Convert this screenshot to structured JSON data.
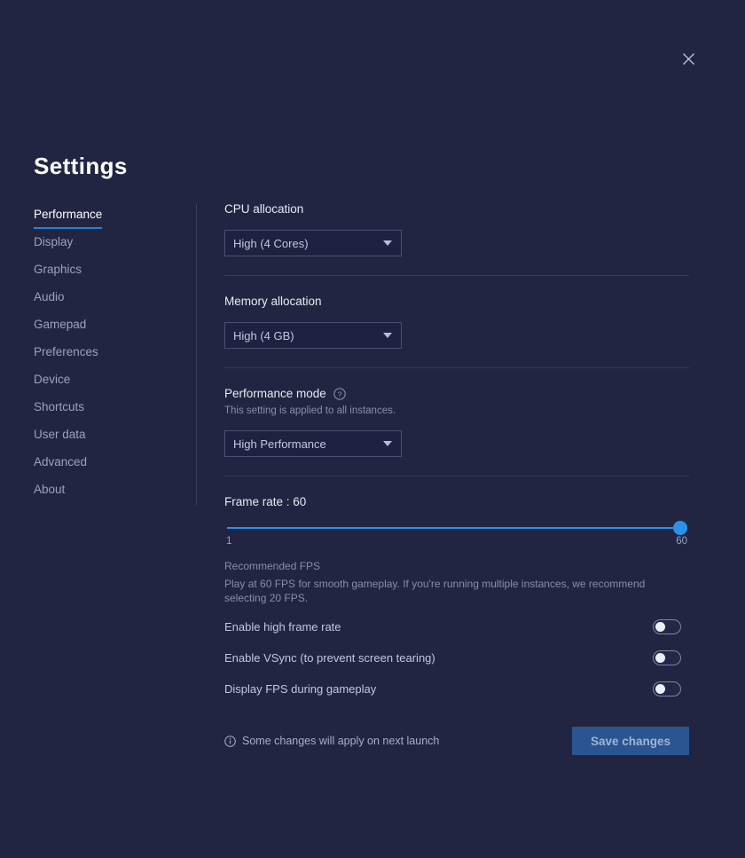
{
  "window": {
    "close_icon": "close-icon",
    "title": "Settings"
  },
  "sidebar": {
    "items": [
      {
        "label": "Performance",
        "active": true
      },
      {
        "label": "Display",
        "active": false
      },
      {
        "label": "Graphics",
        "active": false
      },
      {
        "label": "Audio",
        "active": false
      },
      {
        "label": "Gamepad",
        "active": false
      },
      {
        "label": "Preferences",
        "active": false
      },
      {
        "label": "Device",
        "active": false
      },
      {
        "label": "Shortcuts",
        "active": false
      },
      {
        "label": "User data",
        "active": false
      },
      {
        "label": "Advanced",
        "active": false
      },
      {
        "label": "About",
        "active": false
      }
    ]
  },
  "content": {
    "cpu": {
      "label": "CPU allocation",
      "value": "High (4 Cores)"
    },
    "memory": {
      "label": "Memory allocation",
      "value": "High (4 GB)"
    },
    "performance_mode": {
      "label": "Performance mode",
      "help_icon": "help-circle-icon",
      "description": "This setting is applied to all instances.",
      "value": "High Performance"
    },
    "frame_rate": {
      "label": "Frame rate : 60",
      "value": 60,
      "min_label": "1",
      "max_label": "60",
      "min": 1,
      "max": 60,
      "recommended_title": "Recommended FPS",
      "recommended_body": "Play at 60 FPS for smooth gameplay. If you're running multiple instances, we recommend selecting 20 FPS."
    },
    "toggles": [
      {
        "label": "Enable high frame rate",
        "on": false
      },
      {
        "label": "Enable VSync (to prevent screen tearing)",
        "on": false
      },
      {
        "label": "Display FPS during gameplay",
        "on": false
      }
    ],
    "footer": {
      "info_icon": "info-circle-icon",
      "note": "Some changes will apply on next launch",
      "save_label": "Save changes"
    }
  },
  "colors": {
    "background": "#222541",
    "accent": "#2b8fe8",
    "save_button": "#2a5591",
    "text_primary": "#e8eaf4",
    "text_muted": "#868db0"
  }
}
